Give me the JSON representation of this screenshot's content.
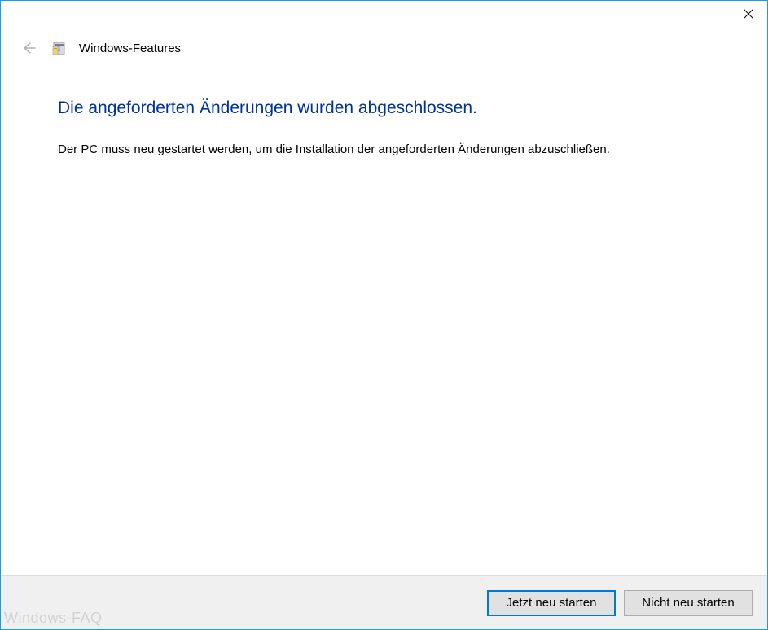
{
  "header": {
    "title": "Windows-Features"
  },
  "content": {
    "heading": "Die angeforderten Änderungen wurden abgeschlossen.",
    "body": "Der PC muss neu gestartet werden, um die Installation der angeforderten Änderungen abzuschließen."
  },
  "footer": {
    "restart_label": "Jetzt neu starten",
    "no_restart_label": "Nicht neu starten"
  },
  "watermark": "Windows-FAQ"
}
